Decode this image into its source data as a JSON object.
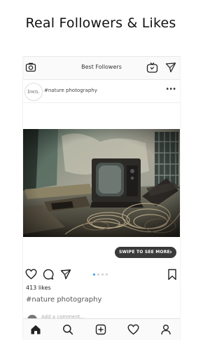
{
  "banner": {
    "title": "Real Followers & Likes"
  },
  "topbar": {
    "title": "Best Followers"
  },
  "post": {
    "avatar_text": "bwn.",
    "hashtag": "#nature photography",
    "more_label": "•••",
    "swipe_label": "SWIPE TO SEE MORE",
    "swipe_chevron": "›",
    "likes": "413 likes",
    "caption": "#nature photography",
    "add_comment_placeholder": "Add a comment...",
    "carousel": {
      "count": 4,
      "active_index": 0
    }
  },
  "colors": {
    "accent": "#3897f0",
    "badge_bg": "#3a3a3a"
  },
  "icons": {
    "topbar": [
      "camera-icon",
      "igtv-icon",
      "send-icon"
    ],
    "actions": [
      "heart-icon",
      "comment-icon",
      "send-icon",
      "bookmark-icon"
    ],
    "bottom_nav": [
      "home-icon",
      "search-icon",
      "add-icon",
      "heart-icon",
      "profile-icon"
    ]
  }
}
